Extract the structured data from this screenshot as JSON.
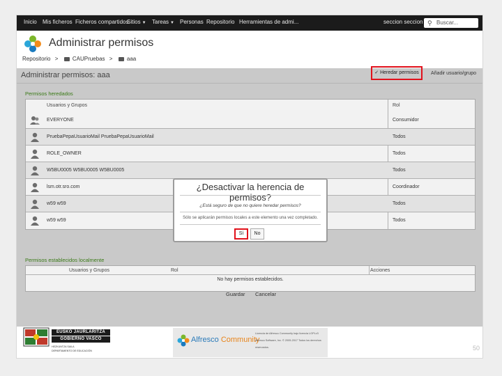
{
  "nav": {
    "items": [
      "Inicio",
      "Mis ficheros",
      "Ficheros compartidos",
      "Sitios",
      "Tareas",
      "Personas",
      "Repositorio",
      "Herramientas de admi..."
    ],
    "user": "seccion seccion",
    "search_placeholder": "Buscar..."
  },
  "header": {
    "app_title": "Administrar permisos",
    "breadcrumb": [
      "Repositorio",
      "CAUPruebas",
      "aaa"
    ]
  },
  "page": {
    "title": "Administrar permisos: aaa",
    "inherit_button": "Heredar permisos",
    "add_user": "Añadir usuario/grupo",
    "inherited_label": "Permisos heredados",
    "local_label": "Permisos establecidos localmente"
  },
  "inherited_table": {
    "headers": [
      "Usuarios y Grupos",
      "Rol"
    ],
    "rows": [
      {
        "name": "EVERYONE",
        "role": "Consumidor"
      },
      {
        "name": "PruebaPepaUsuarioMail PruebaPepaUsuarioMail",
        "role": "Todos"
      },
      {
        "name": "ROLE_OWNER",
        "role": "Todos"
      },
      {
        "name": "W5BU0005 W5BU0005 W5BU0005",
        "role": "Todos"
      },
      {
        "name": "lsm.otr.sro.com",
        "role": "Coordinador"
      },
      {
        "name": "w59 w59",
        "role": "Todos"
      },
      {
        "name": "w59 w59",
        "role": "Todos"
      }
    ]
  },
  "local_table": {
    "headers": [
      "Usuarios y Grupos",
      "Rol",
      "Acciones"
    ],
    "empty": "No hay permisos establecidos."
  },
  "actions": {
    "save": "Guardar",
    "cancel": "Cancelar"
  },
  "dialog": {
    "title": "¿Desactivar la herencia de permisos?",
    "question": "¿Está seguro de que no quiere heredar permisos?",
    "note": "Sólo se aplicarán permisos locales a este elemento una vez completado.",
    "yes": "Sí",
    "no": "No"
  },
  "footer": {
    "gv_line1": "EUSKO JAURLARITZA",
    "gv_line2": "GOBIERNO VASCO",
    "gv_line3": "HEZKUNTZA SAILA",
    "gv_line4": "DEPARTAMENTO DE EDUCACIÓN",
    "alfresco_word": "Alfresco",
    "alfresco_community": "Community",
    "alfresco_small1": "Licencia de Alfresco Community bajo licencia LGPLv3",
    "alfresco_small2": "Alfresco Software, Inc. © 2005-2017 Todos los derechos",
    "alfresco_small3": "reservados.",
    "page_number": "50"
  },
  "colors": {
    "highlight": "#e1111b",
    "section_green": "#3a7a17",
    "navbar": "#1b1b1b"
  }
}
